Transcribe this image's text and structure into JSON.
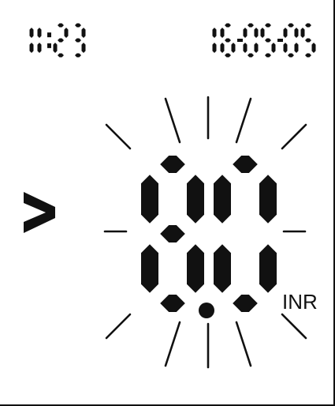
{
  "status_bar": {
    "time": "11:23",
    "date": "16-05-05"
  },
  "reading": {
    "indicator": ">",
    "value": "8.0",
    "unit": "INR",
    "blinking": true
  },
  "colors": {
    "background": "#ffffff",
    "segment": "#111111"
  }
}
